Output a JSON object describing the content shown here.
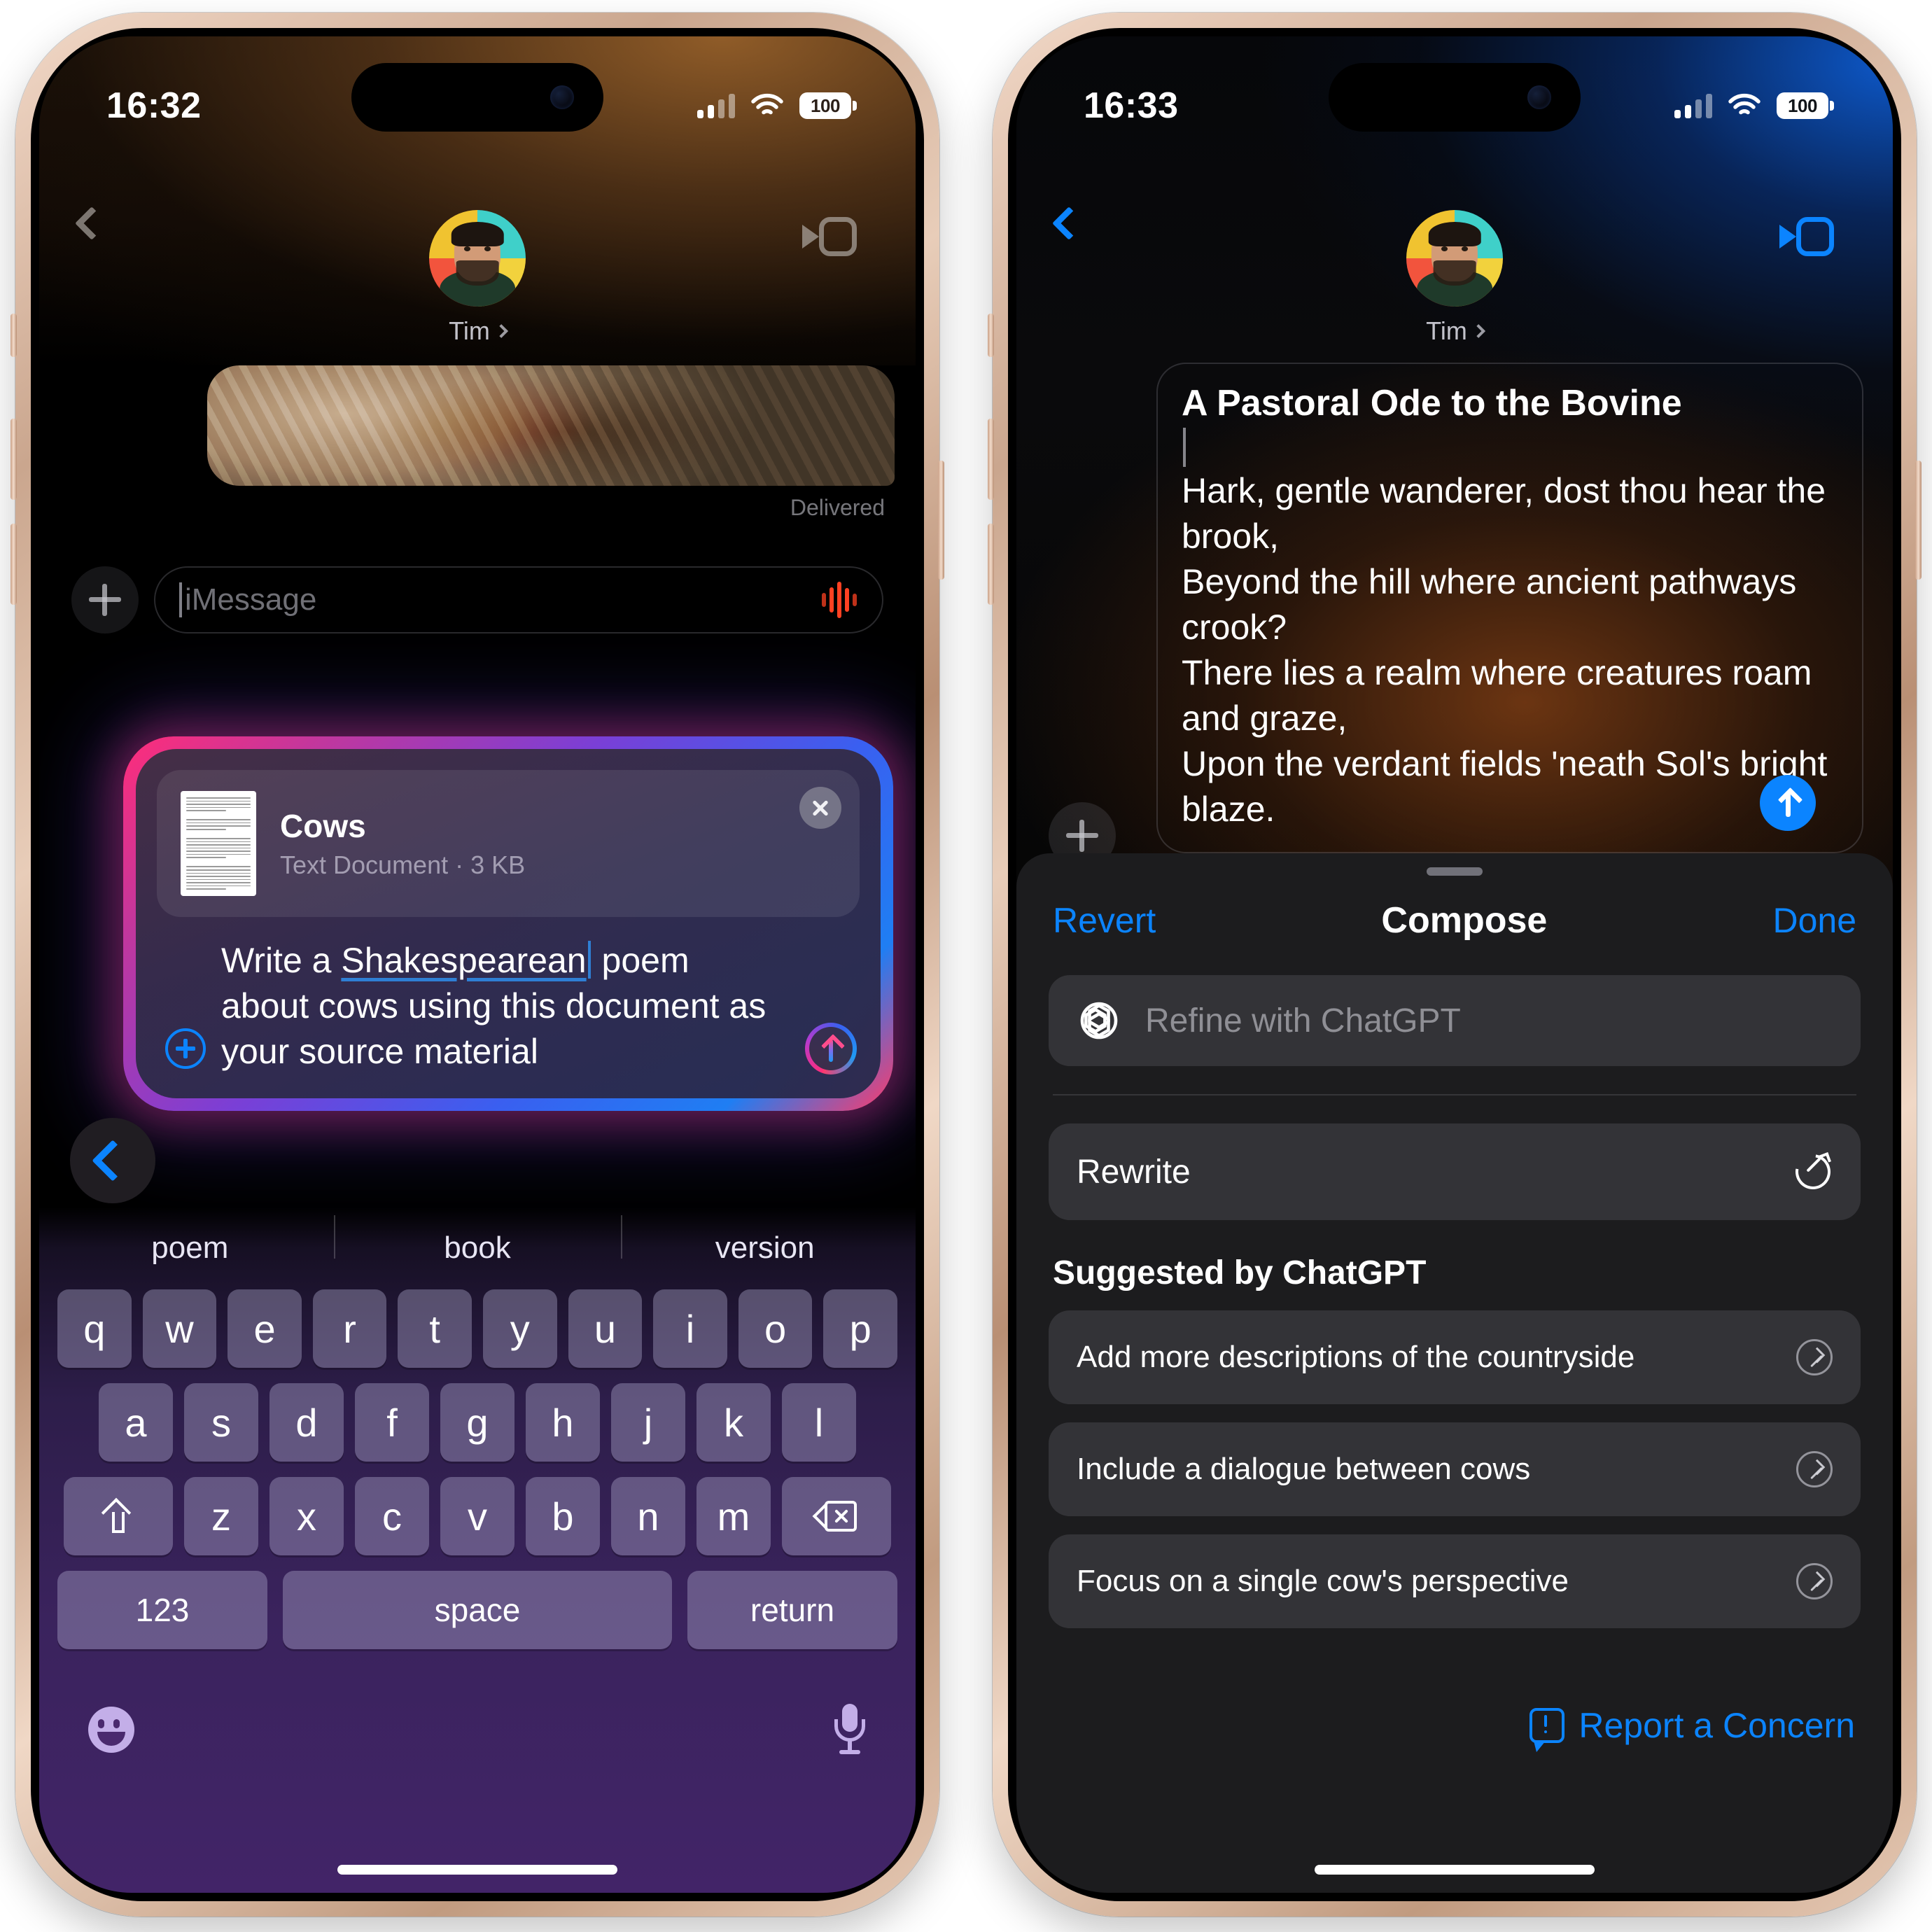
{
  "left_phone": {
    "status": {
      "time": "16:32",
      "battery": "100",
      "signal_icon": "cellular-bars-icon",
      "wifi_icon": "wifi-icon"
    },
    "nav": {
      "back_icon": "chevron-left-icon",
      "contact_name": "Tim",
      "video_icon": "facetime-video-icon"
    },
    "thread": {
      "delivered_label": "Delivered"
    },
    "message_bar": {
      "plus_icon": "plus-icon",
      "placeholder": "iMessage",
      "audio_icon": "audio-waveform-icon"
    },
    "compose": {
      "attachment": {
        "title": "Cows",
        "subtitle": "Text Document · 3 KB",
        "close_icon": "close-circle-icon",
        "thumb_icon": "text-document-thumbnail"
      },
      "prompt_prefix": "Write a ",
      "prompt_underlined": "Shakespearean",
      "prompt_suffix": " poem about cows using this document as your source material",
      "plus_icon": "plus-circle-icon",
      "send_icon": "send-arrow-up-icon"
    },
    "back_button_icon": "chevron-left-circle-icon",
    "keyboard": {
      "suggestions": [
        "poem",
        "book",
        "version"
      ],
      "row1": [
        "q",
        "w",
        "e",
        "r",
        "t",
        "y",
        "u",
        "i",
        "o",
        "p"
      ],
      "row2": [
        "a",
        "s",
        "d",
        "f",
        "g",
        "h",
        "j",
        "k",
        "l"
      ],
      "row3": [
        "z",
        "x",
        "c",
        "v",
        "b",
        "n",
        "m"
      ],
      "shift_icon": "shift-icon",
      "delete_icon": "delete-backward-icon",
      "numbers_label": "123",
      "space_label": "space",
      "return_label": "return",
      "emoji_icon": "emoji-smiley-icon",
      "dictation_icon": "microphone-icon"
    }
  },
  "right_phone": {
    "status": {
      "time": "16:33",
      "battery": "100",
      "signal_icon": "cellular-bars-icon",
      "wifi_icon": "wifi-icon"
    },
    "nav": {
      "back_icon": "chevron-left-icon",
      "contact_name": "Tim",
      "video_icon": "facetime-video-icon"
    },
    "poem": {
      "title": "A Pastoral Ode to the Bovine",
      "body": "Hark, gentle wanderer, dost thou hear the brook,\nBeyond the hill where ancient pathways crook?\nThere lies a realm where creatures roam and graze,\nUpon the verdant fields 'neath Sol's bright blaze."
    },
    "message_bar": {
      "plus_icon": "plus-icon",
      "send_icon": "send-arrow-up-icon"
    },
    "sheet": {
      "revert_label": "Revert",
      "title": "Compose",
      "done_label": "Done",
      "refine_placeholder": "Refine with ChatGPT",
      "chatgpt_icon": "chatgpt-logo-icon",
      "rewrite_label": "Rewrite",
      "rewrite_icon": "rewrite-redo-icon",
      "section_heading": "Suggested by ChatGPT",
      "suggestions": [
        "Add more descriptions of the countryside",
        "Include a dialogue between cows",
        "Focus on a single cow's perspective"
      ],
      "suggestion_icon": "arrow-up-right-circle-icon",
      "report_label": "Report a Concern",
      "report_icon": "exclamation-bubble-icon"
    }
  },
  "colors": {
    "accent_blue": "#0b84ff",
    "sheet_bg": "#1c1c1e",
    "row_bg": "rgba(118,118,128,.26)",
    "audio_red": "#ff4122"
  }
}
